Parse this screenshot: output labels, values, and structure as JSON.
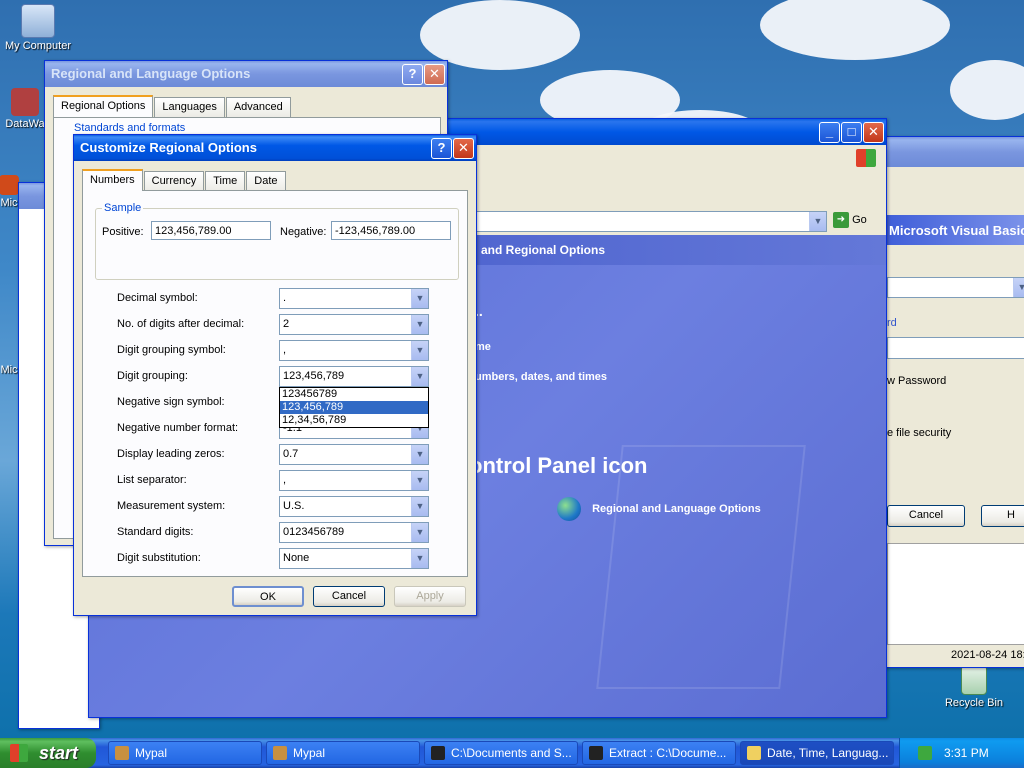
{
  "desktop": {
    "icons": [
      {
        "label": "My Computer"
      },
      {
        "label": "DataWa"
      },
      {
        "label": "Mic"
      },
      {
        "label": "Mic"
      },
      {
        "label": "Recycle Bin"
      }
    ]
  },
  "regional_window": {
    "title": "Regional and Language Options",
    "tabs": [
      "Regional Options",
      "Languages",
      "Advanced"
    ],
    "group_label": "Standards and formats"
  },
  "control_panel": {
    "go_label": "Go",
    "header": "and Regional Options",
    "dots": "..",
    "link_me": "me",
    "link_numbers": "umbers, dates, and times",
    "icon_heading": "ontrol Panel icon",
    "icon_label": "Regional and Language Options"
  },
  "vb_window": {
    "title": "Microsoft Visual Basic",
    "link_rd": "rd",
    "label_password": "w Password",
    "label_security": "e file security",
    "cancel_label": "Cancel",
    "h_label": "H",
    "timestamp": "2021-08-24 18:"
  },
  "customize": {
    "title": "Customize Regional Options",
    "help_glyph": "?",
    "close_glyph": "✕",
    "tabs": [
      "Numbers",
      "Currency",
      "Time",
      "Date"
    ],
    "sample": {
      "group_label": "Sample",
      "positive_label": "Positive:",
      "positive_value": "123,456,789.00",
      "negative_label": "Negative:",
      "negative_value": "-123,456,789.00"
    },
    "rows": [
      {
        "label": "Decimal symbol:",
        "value": "."
      },
      {
        "label": "No. of digits after decimal:",
        "value": "2"
      },
      {
        "label": "Digit grouping symbol:",
        "value": ","
      },
      {
        "label": "Digit grouping:",
        "value": "123,456,789"
      },
      {
        "label": "Negative sign symbol:",
        "value": "-"
      },
      {
        "label": "Negative number format:",
        "value": "-1.1"
      },
      {
        "label": "Display leading zeros:",
        "value": "0.7"
      },
      {
        "label": "List separator:",
        "value": ","
      },
      {
        "label": "Measurement system:",
        "value": "U.S."
      },
      {
        "label": "Standard digits:",
        "value": "0123456789"
      },
      {
        "label": "Digit substitution:",
        "value": "None"
      }
    ],
    "dropdown_options": [
      "123456789",
      "123,456,789",
      "12,34,56,789"
    ],
    "dropdown_selected_index": 1,
    "ok_label": "OK",
    "cancel_label": "Cancel",
    "apply_label": "Apply"
  },
  "taskbar": {
    "start_label": "start",
    "tasks": [
      {
        "label": "Mypal"
      },
      {
        "label": "Mypal"
      },
      {
        "label": "C:\\Documents and S..."
      },
      {
        "label": "Extract : C:\\Docume..."
      },
      {
        "label": "Date, Time, Languag..."
      }
    ],
    "clock": "3:31 PM"
  }
}
